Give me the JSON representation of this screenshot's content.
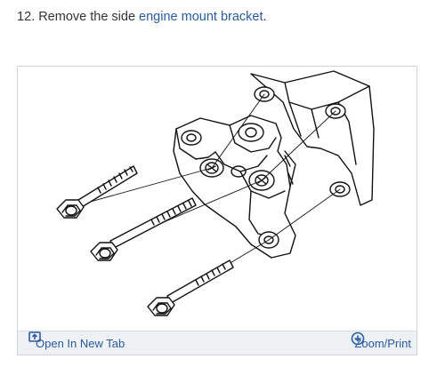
{
  "step": {
    "number": "12.",
    "prefix": "Remove the side",
    "link": "engine mount bracket",
    "suffix": "."
  },
  "figure_bar": {
    "open_tab_label": "Open In New Tab",
    "zoom_label": "Zoom/Print",
    "open_tab_icon": "open-in-new-tab-icon",
    "zoom_icon": "zoom-plus-icon"
  },
  "colors": {
    "link": "#2a5aa0",
    "text": "#333333",
    "bar_bg": "#eef1f4"
  }
}
